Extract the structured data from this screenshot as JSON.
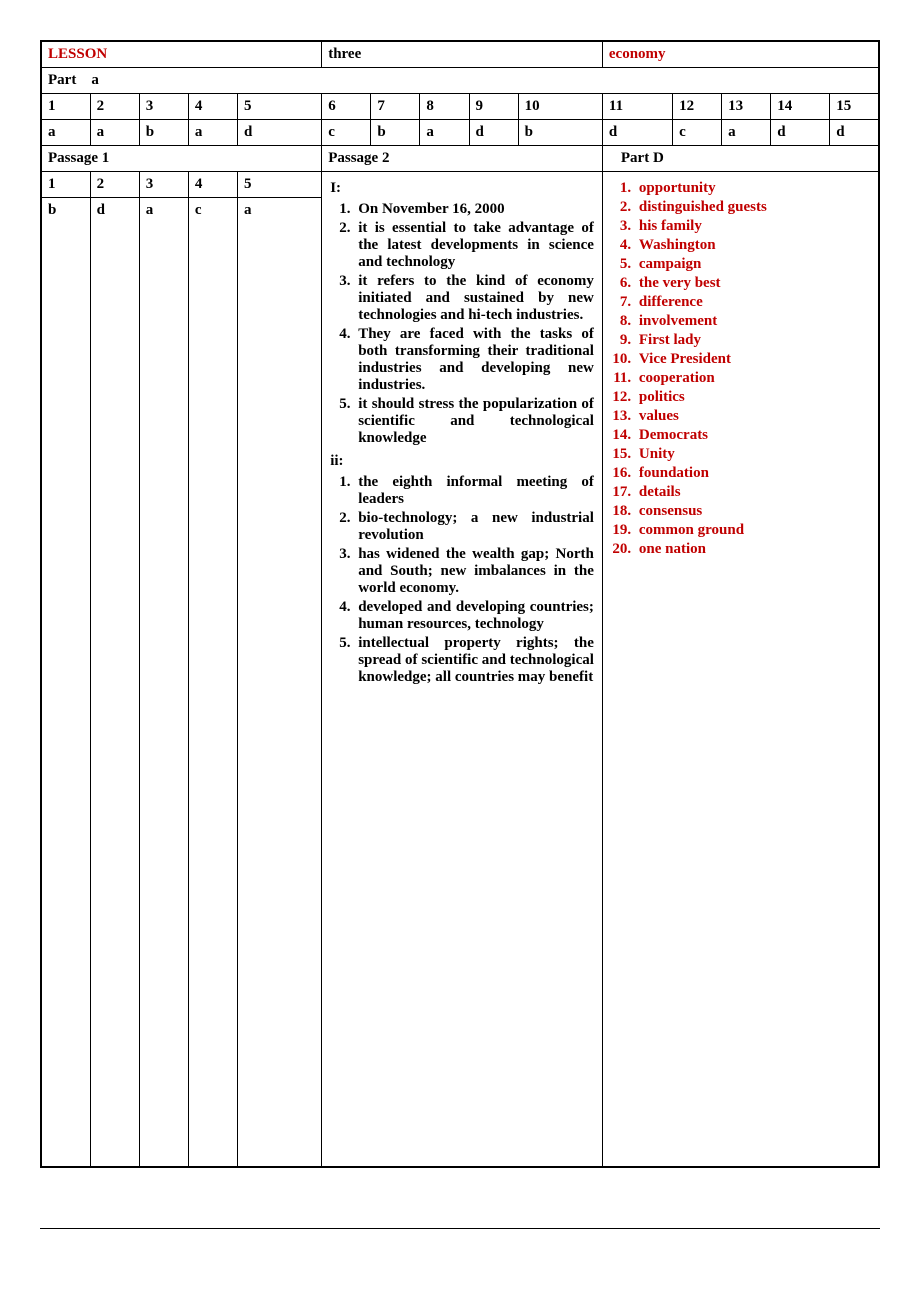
{
  "header": {
    "lesson_label": "LESSON",
    "lesson_value": "three",
    "topic": "economy",
    "part_label": "Part",
    "part_value": "a"
  },
  "row1": {
    "h": [
      "1",
      "2",
      "3",
      "4",
      "5",
      "6",
      "7",
      "8",
      "9",
      "10",
      "11",
      "12",
      "13",
      "14",
      "15"
    ]
  },
  "row1a": {
    "v": [
      "a",
      "a",
      "b",
      "a",
      "d",
      "c",
      "b",
      "a",
      "d",
      "b",
      "d",
      "c",
      "a",
      "d",
      "d"
    ]
  },
  "mid": {
    "passage1": "Passage 1",
    "passage2": "Passage 2",
    "partd": "Part D"
  },
  "row2": {
    "h": [
      "1",
      "2",
      "3",
      "4",
      "5"
    ]
  },
  "row2a": {
    "v": [
      "b",
      "d",
      "a",
      "c",
      "a"
    ]
  },
  "passage2": {
    "label_i": "I:",
    "label_ii": "ii:",
    "i": [
      "On November 16, 2000",
      "it is essential to take advantage of the latest developments in science and technology",
      "it refers to the kind of economy initiated and sustained by new technologies and hi-tech industries.",
      "They are faced with the tasks of both transforming their traditional industries and developing new industries.",
      "it should stress the popularization of scientific and technological knowledge"
    ],
    "ii": [
      "the eighth informal meeting of leaders",
      "bio-technology; a new industrial revolution",
      "has widened the wealth gap; North and South; new imbalances in the world economy.",
      "developed and developing countries; human resources, technology",
      "intellectual property rights; the spread of scientific and technological knowledge; all countries may benefit"
    ]
  },
  "partd": {
    "items": [
      "opportunity",
      "distinguished guests",
      "his family",
      "Washington",
      "campaign",
      "the very best",
      "difference",
      "involvement",
      "First  lady",
      "Vice President",
      "cooperation",
      "politics",
      "values",
      "Democrats",
      "Unity",
      "foundation",
      "details",
      "consensus",
      "common ground",
      "one nation"
    ]
  }
}
